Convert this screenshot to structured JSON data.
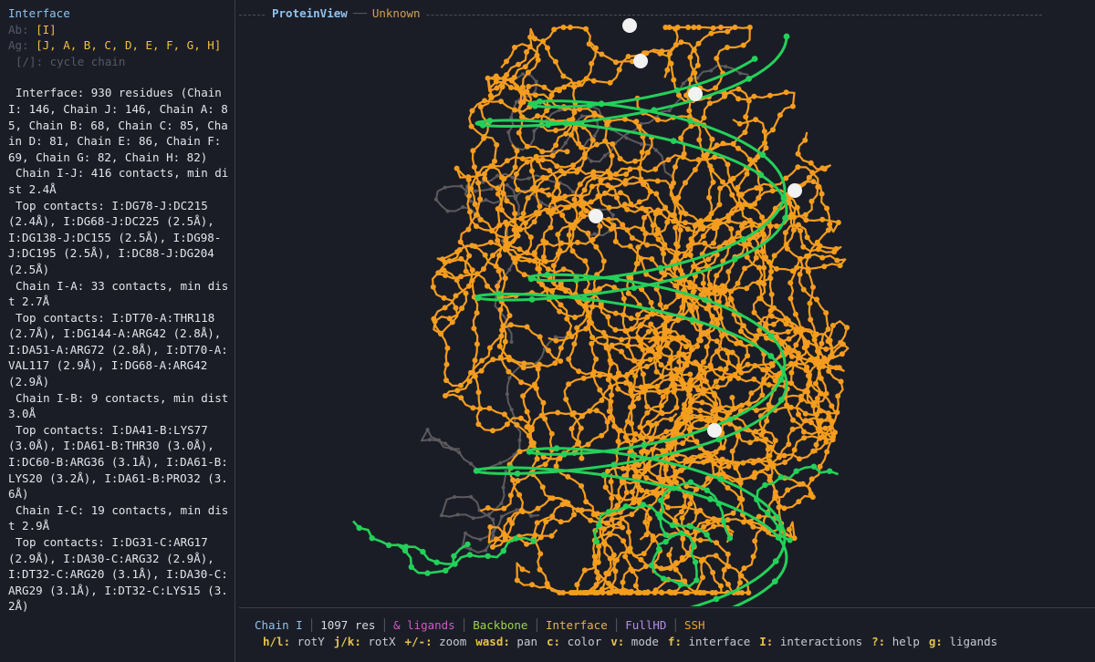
{
  "sidebar": {
    "title": "Interface",
    "ab_label": "Ab:",
    "ab_value": "[I]",
    "ag_label": "Ag:",
    "ag_value": "[J, A, B, C, D, E, F, G, H]",
    "cycle_hint": "[/]: cycle chain",
    "lines": [
      "Interface: 930 residues (Chain I: 146, Chain J: 146, Chain A: 85, Chain B: 68, Chain C: 85, Chain D: 81, Chain E: 86, Chain F: 69, Chain G: 82, Chain H: 82)",
      "Chain I-J: 416 contacts, min dist 2.4Å",
      "Top contacts: I:DG78-J:DC215 (2.4Å), I:DG68-J:DC225 (2.5Å), I:DG138-J:DC155 (2.5Å), I:DG98-J:DC195 (2.5Å), I:DC88-J:DG204 (2.5Å)",
      "Chain I-A: 33 contacts, min dist 2.7Å",
      "Top contacts: I:DT70-A:THR118 (2.7Å), I:DG144-A:ARG42 (2.8Å), I:DA51-A:ARG72 (2.8Å), I:DT70-A:VAL117 (2.9Å), I:DG68-A:ARG42 (2.9Å)",
      "Chain I-B: 9 contacts, min dist 3.0Å",
      "Top contacts: I:DA41-B:LYS77 (3.0Å), I:DA61-B:THR30 (3.0Å), I:DC60-B:ARG36 (3.1Å), I:DA61-B:LYS20 (3.2Å), I:DA61-B:PRO32 (3.6Å)",
      "Chain I-C: 19 contacts, min dist 2.9Å",
      "Top contacts: I:DG31-C:ARG17 (2.9Å), I:DA30-C:ARG32 (2.9Å), I:DT32-C:ARG20 (3.1Å), I:DA30-C:ARG29 (3.1Å), I:DT32-C:LYS15 (3.2Å)"
    ]
  },
  "viewport": {
    "title": "ProteinView",
    "subtitle": "Unknown"
  },
  "status": {
    "chain": "Chain I",
    "residues": "1097 res",
    "ligands": "& ligands",
    "backbone": "Backbone",
    "interface": "Interface",
    "resolution": "FullHD",
    "connection": "SSH"
  },
  "keys": [
    {
      "key": "h/l:",
      "action": "rotY"
    },
    {
      "key": "j/k:",
      "action": "rotX"
    },
    {
      "key": "+/-:",
      "action": "zoom"
    },
    {
      "key": "wasd:",
      "action": "pan"
    },
    {
      "key": "c:",
      "action": "color"
    },
    {
      "key": "v:",
      "action": "mode"
    },
    {
      "key": "f:",
      "action": "interface"
    },
    {
      "key": "I:",
      "action": "interactions"
    },
    {
      "key": "?:",
      "action": "help"
    },
    {
      "key": "g:",
      "action": "ligands"
    }
  ],
  "colors": {
    "dna": "#24d05a",
    "protein": "#f59d1e",
    "ions": "#f2f2f2",
    "background": "#1b1d26"
  }
}
